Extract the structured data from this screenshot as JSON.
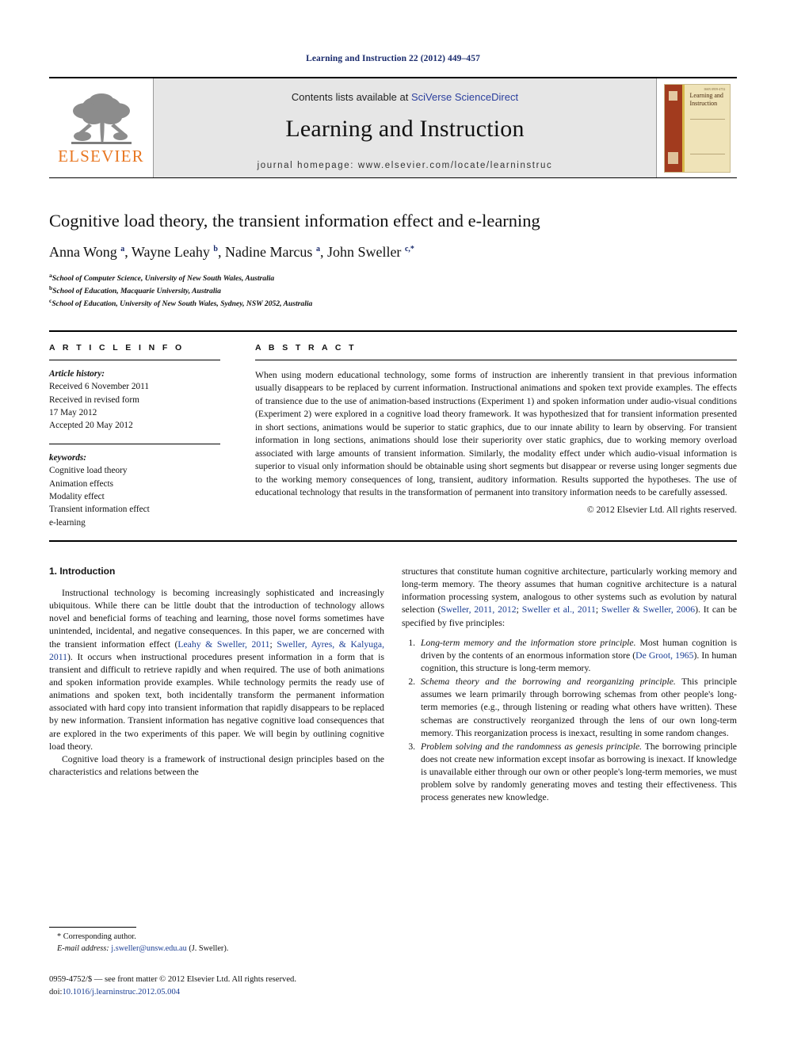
{
  "running_head": "Learning and Instruction 22 (2012) 449–457",
  "masthead": {
    "publisher_name": "ELSEVIER",
    "contents_prefix": "Contents lists available at ",
    "contents_link": "SciVerse ScienceDirect",
    "journal_title": "Learning and Instruction",
    "homepage_line": "journal homepage: www.elsevier.com/locate/learninstruc",
    "cover_title": "Learning and Instruction",
    "cover_issue": "ISSN 0959-4752"
  },
  "article": {
    "title": "Cognitive load theory, the transient information effect and e-learning",
    "authors_html": "Anna Wong <sup>a</sup>, Wayne Leahy <sup>b</sup>, Nadine Marcus <sup>a</sup>, John Sweller <sup>c,*</sup>",
    "affiliations": [
      {
        "marker": "a",
        "text": "School of Computer Science, University of New South Wales, Australia"
      },
      {
        "marker": "b",
        "text": "School of Education, Macquarie University, Australia"
      },
      {
        "marker": "c",
        "text": "School of Education, University of New South Wales, Sydney, NSW 2052, Australia"
      }
    ]
  },
  "article_info": {
    "heading": "A R T I C L E    I N F O",
    "history_label": "Article history:",
    "history_lines": [
      "Received 6 November 2011",
      "Received in revised form",
      "17 May 2012",
      "Accepted 20 May 2012"
    ],
    "keywords_label": "keywords:",
    "keywords": [
      "Cognitive load theory",
      "Animation effects",
      "Modality effect",
      "Transient information effect",
      "e-learning"
    ]
  },
  "abstract": {
    "heading": "A B S T R A C T",
    "text": "When using modern educational technology, some forms of instruction are inherently transient in that previous information usually disappears to be replaced by current information. Instructional animations and spoken text provide examples. The effects of transience due to the use of animation-based instructions (Experiment 1) and spoken information under audio-visual conditions (Experiment 2) were explored in a cognitive load theory framework. It was hypothesized that for transient information presented in short sections, animations would be superior to static graphics, due to our innate ability to learn by observing. For transient information in long sections, animations should lose their superiority over static graphics, due to working memory overload associated with large amounts of transient information. Similarly, the modality effect under which audio-visual information is superior to visual only information should be obtainable using short segments but disappear or reverse using longer segments due to the working memory consequences of long, transient, auditory information. Results supported the hypotheses. The use of educational technology that results in the transformation of permanent into transitory information needs to be carefully assessed.",
    "copyright": "© 2012 Elsevier Ltd. All rights reserved."
  },
  "body": {
    "section_heading": "1. Introduction",
    "left_para_1_a": "Instructional technology is becoming increasingly sophisticated and increasingly ubiquitous. While there can be little doubt that the introduction of technology allows novel and beneficial forms of teaching and learning, those novel forms sometimes have unintended, incidental, and negative consequences. In this paper, we are concerned with the transient information effect (",
    "left_para_1_cite1": "Leahy & Sweller, 2011",
    "left_para_1_b": "; ",
    "left_para_1_cite2": "Sweller, Ayres, & Kalyuga, 2011",
    "left_para_1_c": "). It occurs when instructional procedures present information in a form that is transient and difficult to retrieve rapidly and when required. The use of both animations and spoken information provide examples. While technology permits the ready use of animations and spoken text, both incidentally transform the permanent information associated with hard copy into transient information that rapidly disappears to be replaced by new information. Transient information has negative cognitive load consequences that are explored in the two experiments of this paper. We will begin by outlining cognitive load theory.",
    "left_para_2": "Cognitive load theory is a framework of instructional design principles based on the characteristics and relations between the",
    "right_para_1_a": "structures that constitute human cognitive architecture, particularly working memory and long-term memory. The theory assumes that human cognitive architecture is a natural information processing system, analogous to other systems such as evolution by natural selection (",
    "right_para_1_cite1": "Sweller, 2011, 2012",
    "right_para_1_b": "; ",
    "right_para_1_cite2": "Sweller et al., 2011",
    "right_para_1_c": "; ",
    "right_para_1_cite3": "Sweller & Sweller, 2006",
    "right_para_1_d": "). It can be specified by five principles:",
    "principles": [
      {
        "title": "Long-term memory and the information store principle.",
        "text_a": " Most human cognition is driven by the contents of an enormous information store (",
        "cite": "De Groot, 1965",
        "text_b": "). In human cognition, this structure is long-term memory."
      },
      {
        "title": "Schema theory and the borrowing and reorganizing principle.",
        "text_a": " This principle assumes we learn primarily through borrowing schemas from other people's long-term memories (e.g., through listening or reading what others have written). These schemas are constructively reorganized through the lens of our own long-term memory. This reorganization process is inexact, resulting in some random changes.",
        "cite": "",
        "text_b": ""
      },
      {
        "title": "Problem solving and the randomness as genesis principle.",
        "text_a": " The borrowing principle does not create new information except insofar as borrowing is inexact. If knowledge is unavailable either through our own or other people's long-term memories, we must problem solve by randomly generating moves and testing their effectiveness. This process generates new knowledge.",
        "cite": "",
        "text_b": ""
      }
    ]
  },
  "footer": {
    "corresponding_author": "* Corresponding author.",
    "email_label": "E-mail address:",
    "email": "j.sweller@unsw.edu.au",
    "email_suffix": "(J. Sweller).",
    "issn_line": "0959-4752/$ — see front matter © 2012 Elsevier Ltd. All rights reserved.",
    "doi_label": "doi:",
    "doi": "10.1016/j.learninstruc.2012.05.004"
  },
  "colors": {
    "link_blue": "#1c3f94",
    "running_head_blue": "#1a2b6d",
    "elsevier_orange": "#E87722",
    "masthead_gray": "#e6e6e6"
  }
}
